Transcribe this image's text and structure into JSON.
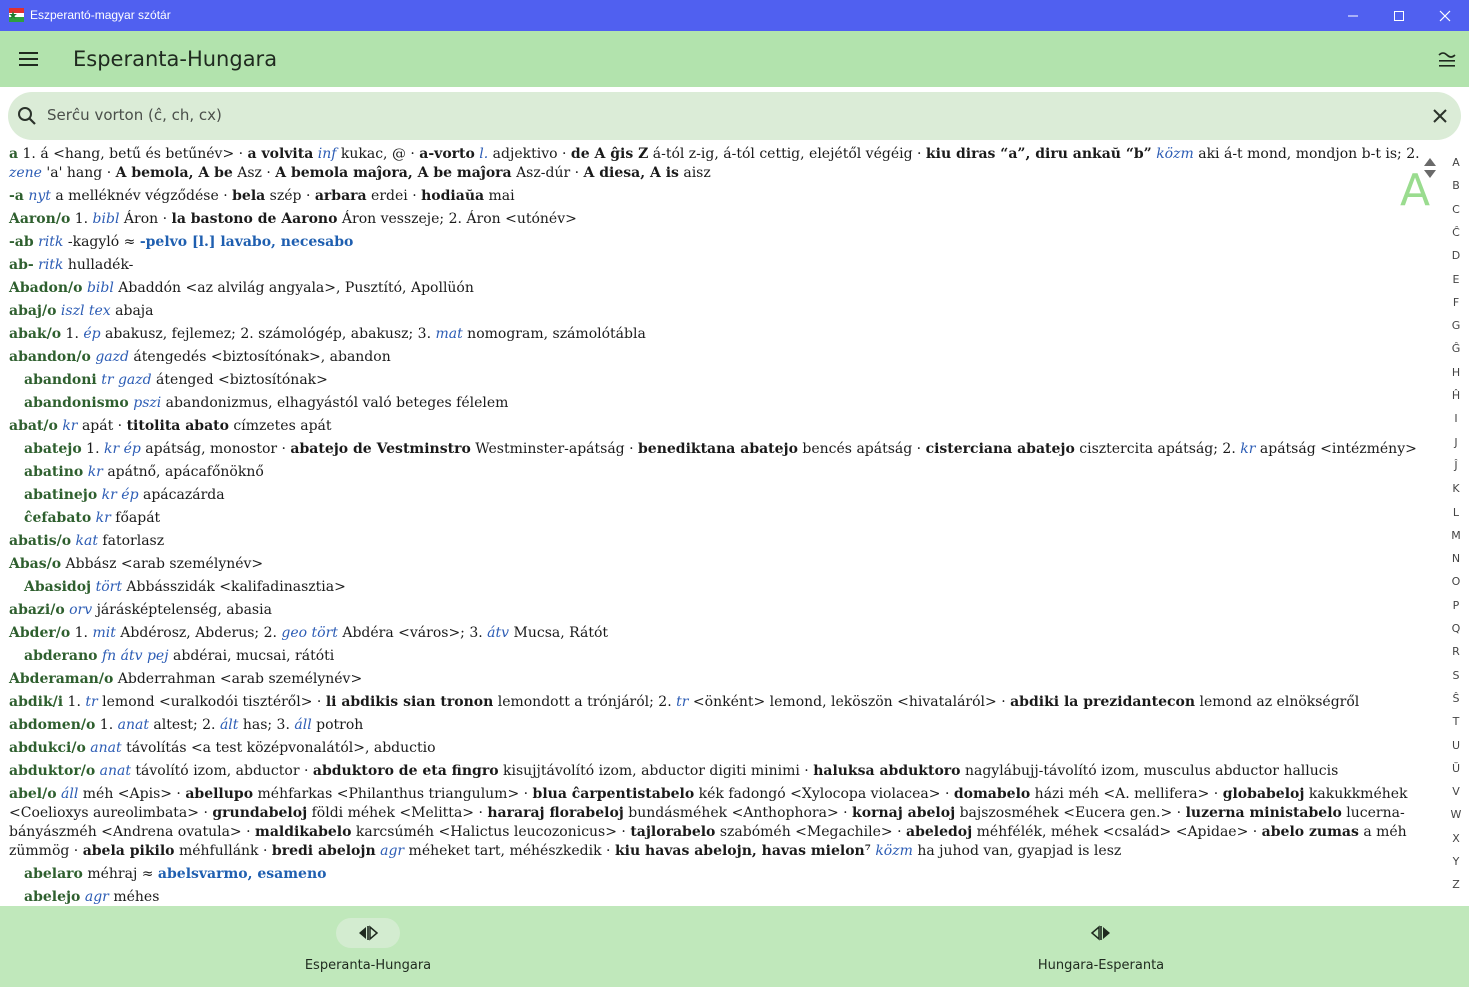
{
  "window": {
    "title": "Eszperantó-magyar szótár",
    "minimize": "—",
    "maximize": "☐",
    "close": "✕"
  },
  "appbar": {
    "title": "Esperanta-Hungara"
  },
  "search": {
    "placeholder": "Serĉu vorton (ĉ, ch, cx)"
  },
  "index_letter": "A",
  "alphabet": [
    "A",
    "B",
    "C",
    "Ĉ",
    "D",
    "E",
    "F",
    "G",
    "Ĝ",
    "H",
    "Ĥ",
    "I",
    "J",
    "Ĵ",
    "K",
    "L",
    "M",
    "N",
    "O",
    "P",
    "Q",
    "R",
    "S",
    "Ŝ",
    "T",
    "U",
    "Ŭ",
    "V",
    "W",
    "X",
    "Y",
    "Z"
  ],
  "entries": [
    {
      "sub": false,
      "parts": [
        [
          "hw",
          "a"
        ],
        [
          "t",
          " 1. á <hang, betű és betűnév> · "
        ],
        [
          "b",
          "a volvita"
        ],
        [
          "t",
          " "
        ],
        [
          "lbl",
          "inf"
        ],
        [
          "t",
          " kukac, @ · "
        ],
        [
          "b",
          "a-vorto"
        ],
        [
          "t",
          " "
        ],
        [
          "lbl",
          "l."
        ],
        [
          "t",
          " adjektivo · "
        ],
        [
          "b",
          "de A ĝis Z"
        ],
        [
          "t",
          " á-tól z-ig, á-tól cettig, elejétől végéig · "
        ],
        [
          "b",
          "kiu diras “a”, diru ankaŭ “b”"
        ],
        [
          "t",
          " "
        ],
        [
          "lbl",
          "közm"
        ],
        [
          "t",
          " aki á-t mond, mondjon b-t is; 2. "
        ],
        [
          "lbl",
          "zene"
        ],
        [
          "t",
          " 'a' hang · "
        ],
        [
          "b",
          "A bemola, A be"
        ],
        [
          "t",
          " Asz · "
        ],
        [
          "b",
          "A bemola maĵora, A be maĵora"
        ],
        [
          "t",
          " Asz-dúr · "
        ],
        [
          "b",
          "A diesa, A is"
        ],
        [
          "t",
          " aisz"
        ]
      ]
    },
    {
      "sub": false,
      "parts": [
        [
          "hw",
          "-a"
        ],
        [
          "t",
          " "
        ],
        [
          "lbl",
          "nyt"
        ],
        [
          "t",
          " a melléknév végződése · "
        ],
        [
          "b",
          "bela"
        ],
        [
          "t",
          " szép · "
        ],
        [
          "b",
          "arbara"
        ],
        [
          "t",
          " erdei · "
        ],
        [
          "b",
          "hodiaŭa"
        ],
        [
          "t",
          " mai"
        ]
      ]
    },
    {
      "sub": false,
      "parts": [
        [
          "hw",
          "Aaron/o"
        ],
        [
          "t",
          " 1. "
        ],
        [
          "lbl",
          "bibl"
        ],
        [
          "t",
          " Áron · "
        ],
        [
          "b",
          "la bastono de Aarono"
        ],
        [
          "t",
          " Áron vesszeje; 2. Áron <utónév>"
        ]
      ]
    },
    {
      "sub": false,
      "parts": [
        [
          "hw",
          "-ab"
        ],
        [
          "t",
          " "
        ],
        [
          "lbl",
          "ritk"
        ],
        [
          "t",
          " -kagyló ≈ "
        ],
        [
          "ref",
          "-pelvo [l.] lavabo, necesabo"
        ]
      ]
    },
    {
      "sub": false,
      "parts": [
        [
          "hw",
          "ab-"
        ],
        [
          "t",
          " "
        ],
        [
          "lbl",
          "ritk"
        ],
        [
          "t",
          " hulladék-"
        ]
      ]
    },
    {
      "sub": false,
      "parts": [
        [
          "hw",
          "Abadon/o"
        ],
        [
          "t",
          " "
        ],
        [
          "lbl",
          "bibl"
        ],
        [
          "t",
          " Abaddón <az alvilág angyala>, Pusztító, Apollüón"
        ]
      ]
    },
    {
      "sub": false,
      "parts": [
        [
          "hw",
          "abaj/o"
        ],
        [
          "t",
          " "
        ],
        [
          "lbl",
          "iszl tex"
        ],
        [
          "t",
          " abaja"
        ]
      ]
    },
    {
      "sub": false,
      "parts": [
        [
          "hw",
          "abak/o"
        ],
        [
          "t",
          " 1. "
        ],
        [
          "lbl",
          "ép"
        ],
        [
          "t",
          " abakusz, fejlemez; 2. számológép, abakusz; 3. "
        ],
        [
          "lbl",
          "mat"
        ],
        [
          "t",
          " nomogram, számolótábla"
        ]
      ]
    },
    {
      "sub": false,
      "parts": [
        [
          "hw",
          "abandon/o"
        ],
        [
          "t",
          " "
        ],
        [
          "lbl",
          "gazd"
        ],
        [
          "t",
          " átengedés <biztosítónak>, abandon"
        ]
      ]
    },
    {
      "sub": true,
      "parts": [
        [
          "hw",
          "abandoni"
        ],
        [
          "t",
          " "
        ],
        [
          "lbl",
          "tr gazd"
        ],
        [
          "t",
          " átenged <biztosítónak>"
        ]
      ]
    },
    {
      "sub": true,
      "parts": [
        [
          "hw",
          "abandonismo"
        ],
        [
          "t",
          " "
        ],
        [
          "lbl",
          "pszi"
        ],
        [
          "t",
          " abandonizmus, elhagyástól való beteges félelem"
        ]
      ]
    },
    {
      "sub": false,
      "parts": [
        [
          "hw",
          "abat/o"
        ],
        [
          "t",
          " "
        ],
        [
          "lbl",
          "kr"
        ],
        [
          "t",
          " apát · "
        ],
        [
          "b",
          "titolita abato"
        ],
        [
          "t",
          " címzetes apát"
        ]
      ]
    },
    {
      "sub": true,
      "parts": [
        [
          "hw",
          "abatejo"
        ],
        [
          "t",
          " 1. "
        ],
        [
          "lbl",
          "kr ép"
        ],
        [
          "t",
          " apátság, monostor · "
        ],
        [
          "b",
          "abatejo de Vestminstro"
        ],
        [
          "t",
          " Westminster-apátság · "
        ],
        [
          "b",
          "benediktana abatejo"
        ],
        [
          "t",
          " bencés apátság · "
        ],
        [
          "b",
          "cisterciana abatejo"
        ],
        [
          "t",
          " ciszterci­ta apátság; 2. "
        ],
        [
          "lbl",
          "kr"
        ],
        [
          "t",
          " apátság <intézmény>"
        ]
      ]
    },
    {
      "sub": true,
      "parts": [
        [
          "hw",
          "abatino"
        ],
        [
          "t",
          " "
        ],
        [
          "lbl",
          "kr"
        ],
        [
          "t",
          " apátnő, apácafőnöknő"
        ]
      ]
    },
    {
      "sub": true,
      "parts": [
        [
          "hw",
          "abatinejo"
        ],
        [
          "t",
          " "
        ],
        [
          "lbl",
          "kr ép"
        ],
        [
          "t",
          " apácazárda"
        ]
      ]
    },
    {
      "sub": true,
      "parts": [
        [
          "hw",
          "ĉefabato"
        ],
        [
          "t",
          " "
        ],
        [
          "lbl",
          "kr"
        ],
        [
          "t",
          " főapát"
        ]
      ]
    },
    {
      "sub": false,
      "parts": [
        [
          "hw",
          "abatis/o"
        ],
        [
          "t",
          " "
        ],
        [
          "lbl",
          "kat"
        ],
        [
          "t",
          " fatorlasz"
        ]
      ]
    },
    {
      "sub": false,
      "parts": [
        [
          "hw",
          "Abas/o"
        ],
        [
          "t",
          " Abbász <arab személynév>"
        ]
      ]
    },
    {
      "sub": true,
      "parts": [
        [
          "hw",
          "Abasidoj"
        ],
        [
          "t",
          " "
        ],
        [
          "lbl",
          "tört"
        ],
        [
          "t",
          " Abbásszidák <kalifadinasztia>"
        ]
      ]
    },
    {
      "sub": false,
      "parts": [
        [
          "hw",
          "abazi/o"
        ],
        [
          "t",
          " "
        ],
        [
          "lbl",
          "orv"
        ],
        [
          "t",
          " járásképtelenség, abasia"
        ]
      ]
    },
    {
      "sub": false,
      "parts": [
        [
          "hw",
          "Abder/o"
        ],
        [
          "t",
          " 1. "
        ],
        [
          "lbl",
          "mit"
        ],
        [
          "t",
          " Abdérosz, Abderus; 2. "
        ],
        [
          "lbl",
          "geo tört"
        ],
        [
          "t",
          " Abdéra <város>; 3. "
        ],
        [
          "lbl",
          "átv"
        ],
        [
          "t",
          " Mucsa, Rátót"
        ]
      ]
    },
    {
      "sub": true,
      "parts": [
        [
          "hw",
          "abderano"
        ],
        [
          "t",
          " "
        ],
        [
          "lbl",
          "fn átv pej"
        ],
        [
          "t",
          " abdérai, mucsai, rátóti"
        ]
      ]
    },
    {
      "sub": false,
      "parts": [
        [
          "hw",
          "Abderaman/o"
        ],
        [
          "t",
          " Abderrahman <arab személynév>"
        ]
      ]
    },
    {
      "sub": false,
      "parts": [
        [
          "hw",
          "abdik/i"
        ],
        [
          "t",
          " 1. "
        ],
        [
          "lbl",
          "tr"
        ],
        [
          "t",
          " lemond <uralkodói tisztéről> · "
        ],
        [
          "b",
          "li abdikis sian tronon"
        ],
        [
          "t",
          " lemondott a trónjáról; 2. "
        ],
        [
          "lbl",
          "tr"
        ],
        [
          "t",
          " <önként> lemond, leköszön <hivataláról> · "
        ],
        [
          "b",
          "abdiki la prezidantecon"
        ],
        [
          "t",
          " lemond az elnökségről"
        ]
      ]
    },
    {
      "sub": false,
      "parts": [
        [
          "hw",
          "abdomen/o"
        ],
        [
          "t",
          " 1. "
        ],
        [
          "lbl",
          "anat"
        ],
        [
          "t",
          " altest; 2. "
        ],
        [
          "lbl",
          "ált"
        ],
        [
          "t",
          " has; 3. "
        ],
        [
          "lbl",
          "áll"
        ],
        [
          "t",
          " potroh"
        ]
      ]
    },
    {
      "sub": false,
      "parts": [
        [
          "hw",
          "abdukci/o"
        ],
        [
          "t",
          " "
        ],
        [
          "lbl",
          "anat"
        ],
        [
          "t",
          " távolítás <a test középvonalától>, abductio"
        ]
      ]
    },
    {
      "sub": false,
      "parts": [
        [
          "hw",
          "abduktor/o"
        ],
        [
          "t",
          " "
        ],
        [
          "lbl",
          "anat"
        ],
        [
          "t",
          " távolító izom, abductor · "
        ],
        [
          "b",
          "abduktoro de eta fingro"
        ],
        [
          "t",
          " kisujjtávolító izom, abductor digiti minimi · "
        ],
        [
          "b",
          "haluksa abduktoro"
        ],
        [
          "t",
          " nagylábujj-távolító izom, musculus abductor hallucis"
        ]
      ]
    },
    {
      "sub": false,
      "parts": [
        [
          "hw",
          "abel/o"
        ],
        [
          "t",
          " "
        ],
        [
          "lbl",
          "áll"
        ],
        [
          "t",
          " méh <Apis> · "
        ],
        [
          "b",
          "abellupo"
        ],
        [
          "t",
          " méhfarkas <Philanthus triangulum> · "
        ],
        [
          "b",
          "blua ĉarpentistabelo"
        ],
        [
          "t",
          " kék fadongó <Xylocopa violacea> · "
        ],
        [
          "b",
          "domabelo"
        ],
        [
          "t",
          " házi méh <A. mellifera> · "
        ],
        [
          "b",
          "globabeloj"
        ],
        [
          "t",
          " kakukkméhek <Coelioxys aureolimbata> · "
        ],
        [
          "b",
          "grundabeloj"
        ],
        [
          "t",
          " földi méhek <Melitta> · "
        ],
        [
          "b",
          "hararaj florabeloj"
        ],
        [
          "t",
          " bundásméhek <Anthophora> · "
        ],
        [
          "b",
          "kornaj abeloj"
        ],
        [
          "t",
          " bajszosméhek <Eucera gen.> · "
        ],
        [
          "b",
          "luzerna ministabelo"
        ],
        [
          "t",
          " lucerna-bányászméh <Andrena ovatula> · "
        ],
        [
          "b",
          "maldikabelo"
        ],
        [
          "t",
          " karcsúméh <Halictus leucozonicus> · "
        ],
        [
          "b",
          "tajlorabelo"
        ],
        [
          "t",
          " szabóméh <Megachile> · "
        ],
        [
          "b",
          "abeledoj"
        ],
        [
          "t",
          " méhfélék, méhek <család> <Apidae> · "
        ],
        [
          "b",
          "abelo zumas"
        ],
        [
          "t",
          " a méh zümmög · "
        ],
        [
          "b",
          "abela pikilo"
        ],
        [
          "t",
          " méhfullánk · "
        ],
        [
          "b",
          "bredi abelojn"
        ],
        [
          "t",
          " "
        ],
        [
          "lbl",
          "agr"
        ],
        [
          "t",
          " méheket tart, méhészkedik · "
        ],
        [
          "b",
          "kiu havas abelojn, havas mielon⁷"
        ],
        [
          "t",
          " "
        ],
        [
          "lbl",
          "közm"
        ],
        [
          "t",
          " ha juhod van, gyapjad is lesz"
        ]
      ]
    },
    {
      "sub": true,
      "parts": [
        [
          "hw",
          "abelaro"
        ],
        [
          "t",
          " méhraj ≈ "
        ],
        [
          "ref",
          "abelsvarmo, esameno"
        ]
      ]
    },
    {
      "sub": true,
      "parts": [
        [
          "hw",
          "abelejo"
        ],
        [
          "t",
          " "
        ],
        [
          "lbl",
          "agr"
        ],
        [
          "t",
          " méhes"
        ]
      ]
    }
  ],
  "bottom_nav": [
    {
      "label": "Esperanta-Hungara",
      "selected": true
    },
    {
      "label": "Hungara-Esperanta",
      "selected": false
    }
  ]
}
